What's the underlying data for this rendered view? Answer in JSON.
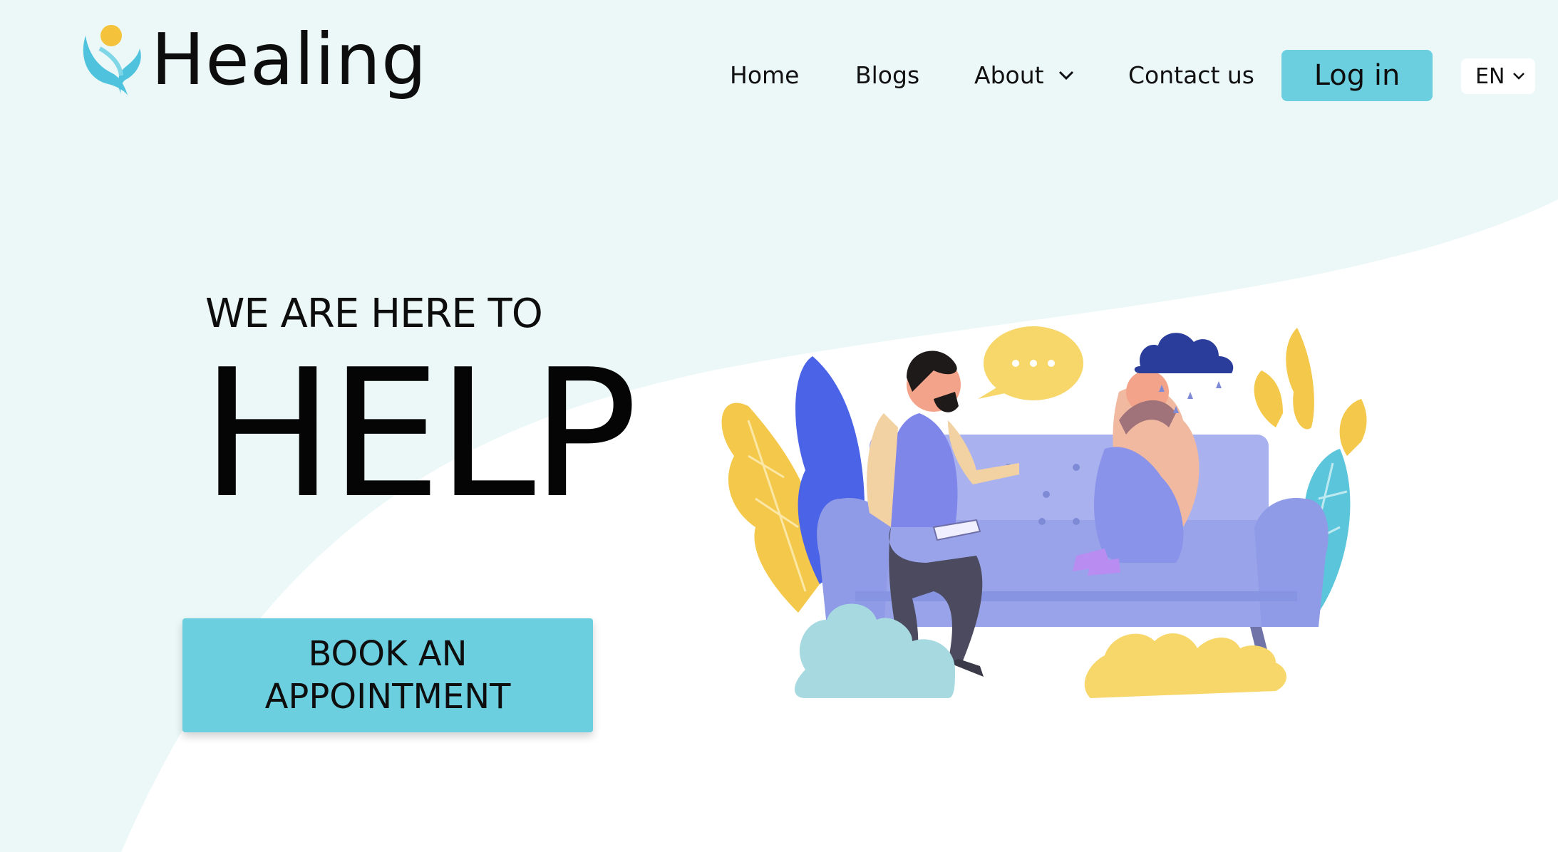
{
  "brand": {
    "name": "Healing"
  },
  "nav": {
    "items": [
      {
        "label": "Home"
      },
      {
        "label": "Blogs"
      },
      {
        "label": "About"
      },
      {
        "label": "Contact us"
      }
    ],
    "login_label": "Log in",
    "language": "EN"
  },
  "hero": {
    "subtitle": "WE ARE HERE TO",
    "title": "HELP",
    "cta_label": "BOOK AN APPOINTMENT"
  },
  "colors": {
    "accent": "#6bcfe0",
    "background_tint": "#ebf8f7",
    "yellow": "#f4c84a",
    "sofa": "#98a3ea",
    "blue": "#4b63e6",
    "cloud": "#2a3d9b"
  },
  "icons": {
    "logo": "healing-logo-icon",
    "about_dropdown": "chevron-down-icon",
    "language_dropdown": "chevron-down-icon",
    "chat_bubble": "speech-bubble-icon",
    "rain_cloud": "rain-cloud-icon"
  }
}
